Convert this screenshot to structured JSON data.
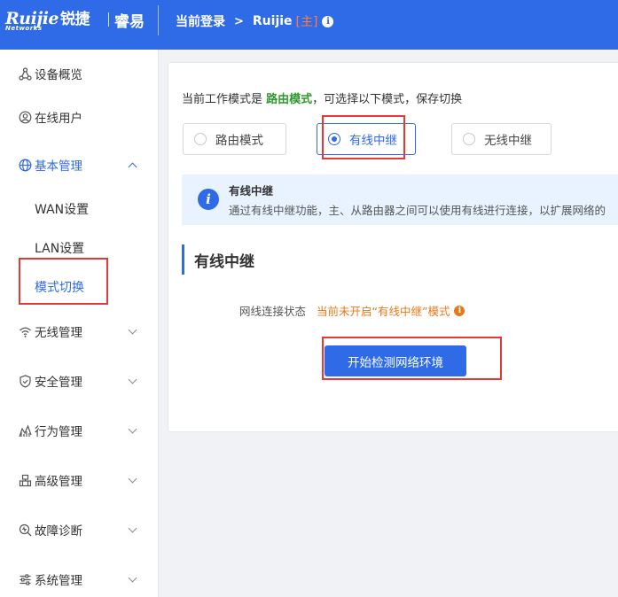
{
  "header": {
    "brand": "Ruijie",
    "brand_cn": "锐捷",
    "brand_sub": "Networks",
    "sub_brand": "睿易",
    "breadcrumb_root": "当前登录",
    "device_name": "Ruijie",
    "device_tag": "[主]",
    "info_icon": "i"
  },
  "sidebar": {
    "items": [
      {
        "label": "设备概览",
        "icon": "topology-icon"
      },
      {
        "label": "在线用户",
        "icon": "user-icon"
      },
      {
        "label": "基本管理",
        "icon": "globe-icon"
      },
      {
        "label": "无线管理",
        "icon": "wifi-icon"
      },
      {
        "label": "安全管理",
        "icon": "shield-icon"
      },
      {
        "label": "行为管理",
        "icon": "chart-icon"
      },
      {
        "label": "高级管理",
        "icon": "advanced-icon"
      },
      {
        "label": "故障诊断",
        "icon": "diagnose-icon"
      },
      {
        "label": "系统管理",
        "icon": "settings-icon"
      }
    ],
    "sub_items": [
      "WAN设置",
      "LAN设置",
      "模式切换"
    ],
    "active_sub": "模式切换"
  },
  "main": {
    "mode_prefix": "当前工作模式是",
    "current_mode": "路由模式",
    "mode_suffix": "，可选择以下模式，保存切换",
    "options": [
      "路由模式",
      "有线中继",
      "无线中继"
    ],
    "selected_option": "有线中继",
    "info_title": "有线中继",
    "info_desc": "通过有线中继功能，主、从路由器之间可以使用有线进行连接，以扩展网络的",
    "info_icon": "i",
    "section_title": "有线中继",
    "status_label": "网线连接状态",
    "status_value": "当前未开启“有线中继”模式",
    "warn_icon": "i",
    "detect_button": "开始检测网络环境"
  },
  "colors": {
    "primary": "#2f6be6",
    "success": "#2e9a2e",
    "warning": "#e8791b",
    "highlight_box": "#e53935"
  }
}
